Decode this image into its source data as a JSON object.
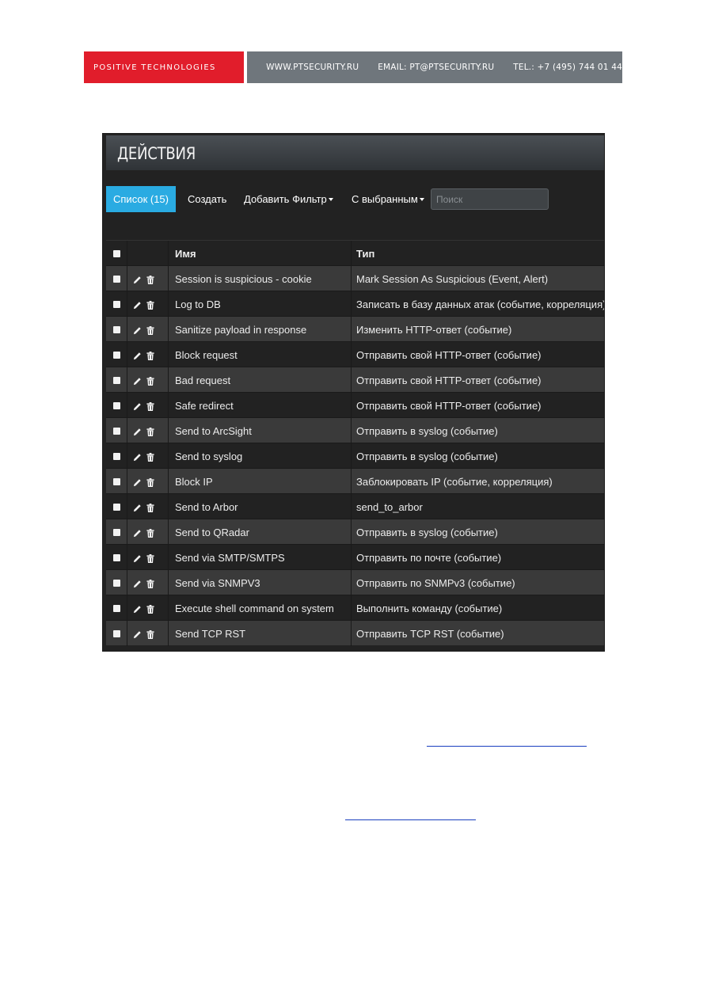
{
  "letterhead": {
    "brand": "POSITIVE TECHNOLOGIES",
    "site": "WWW.PTSECURITY.RU",
    "email": "EMAIL: PT@PTSECURITY.RU",
    "tel": "TEL.: +7 (495) 744 01 44",
    "brand_color": "#e11d2b",
    "info_bg_color": "#6f767c"
  },
  "app": {
    "title": "ДЕЙСТВИЯ",
    "toolbar": {
      "list_tab": "Список (15)",
      "create": "Создать",
      "add_filter": "Добавить Фильтр",
      "with_selected": "С выбранным",
      "search_placeholder": "Поиск"
    },
    "accent_color": "#2aabe2",
    "table": {
      "headers": {
        "name": "Имя",
        "type": "Тип"
      },
      "rows": [
        {
          "name": "Session is suspicious - cookie",
          "type": "Mark Session As Suspicious (Event, Alert)"
        },
        {
          "name": "Log to DB",
          "type": "Записать в базу данных атак (событие, корреляция)"
        },
        {
          "name": "Sanitize payload in response",
          "type": "Изменить HTTP-ответ (событие)"
        },
        {
          "name": "Block request",
          "type": "Отправить свой HTTP-ответ (событие)"
        },
        {
          "name": "Bad request",
          "type": "Отправить свой HTTP-ответ (событие)"
        },
        {
          "name": "Safe redirect",
          "type": "Отправить свой HTTP-ответ (событие)"
        },
        {
          "name": "Send to ArcSight",
          "type": "Отправить в syslog (событие)"
        },
        {
          "name": "Send to syslog",
          "type": "Отправить в syslog (событие)"
        },
        {
          "name": "Block IP",
          "type": "Заблокировать IP (событие, корреляция)"
        },
        {
          "name": "Send to Arbor",
          "type": "send_to_arbor"
        },
        {
          "name": "Send to QRadar",
          "type": "Отправить в syslog (событие)"
        },
        {
          "name": "Send via SMTP/SMTPS",
          "type": "Отправить по почте (событие)"
        },
        {
          "name": "Send via SNMPV3",
          "type": "Отправить по SNMPv3 (событие)"
        },
        {
          "name": "Execute shell command on system",
          "type": "Выполнить команду (событие)"
        },
        {
          "name": "Send TCP RST",
          "type": "Отправить TCP RST (событие)"
        }
      ]
    }
  },
  "icons": {
    "edit": "pencil-icon",
    "delete": "trash-icon",
    "dropdown": "caret-down-icon"
  }
}
